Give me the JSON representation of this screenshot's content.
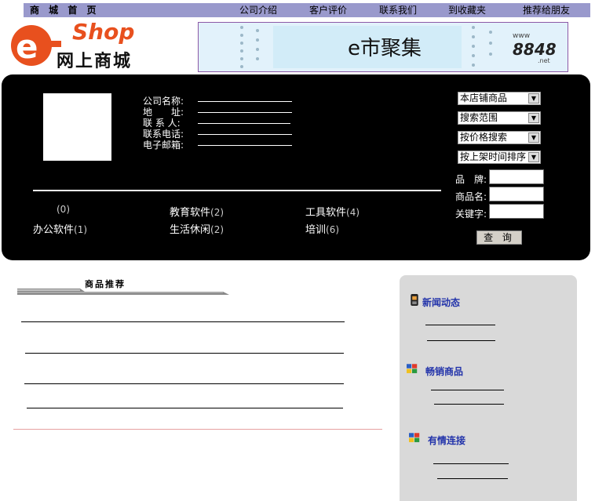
{
  "nav": {
    "home": "商 城 首 页",
    "about": "公司介绍",
    "reviews": "客户评价",
    "contact": "联系我们",
    "favorite": "到收藏夹",
    "recommend": "推荐给朋友"
  },
  "logo": {
    "shop": "Shop",
    "subtitle": "网上商城"
  },
  "banner": {
    "title": "e市聚集",
    "url_top": "www",
    "url_num": "8848",
    "url_net": ".net"
  },
  "company": {
    "name_label": "公司名称:",
    "address_label": "地　　址:",
    "contact_label": "联 系 人:",
    "phone_label": "联系电话:",
    "email_label": "电子邮箱:"
  },
  "categories": [
    {
      "name": "",
      "count": "(0)"
    },
    {
      "name": "教育软件",
      "count": "(2)"
    },
    {
      "name": "工具软件",
      "count": "(4)"
    },
    {
      "name": "办公软件",
      "count": "(1)"
    },
    {
      "name": "生活休闲",
      "count": "(2)"
    },
    {
      "name": "培训",
      "count": "(6)"
    }
  ],
  "search": {
    "scope_select": "本店铺商品",
    "range_select": "搜索范围",
    "price_select": "按价格搜索",
    "sort_select": "按上架时间排序",
    "brand_label": "品　牌:",
    "product_label": "商品名:",
    "keyword_label": "关键字:",
    "query_button": "查 询"
  },
  "recommend": {
    "title": "商品推荐"
  },
  "sidebar": {
    "news": "新闻动态",
    "bestsellers": "畅销商品",
    "links": "有情连接"
  },
  "colors": {
    "nav_bg": "#9999cc",
    "panel_bg": "#000000",
    "logo_orange": "#e8501e",
    "sidebar_bg": "#d9d9d9",
    "link_blue": "#2233aa"
  }
}
